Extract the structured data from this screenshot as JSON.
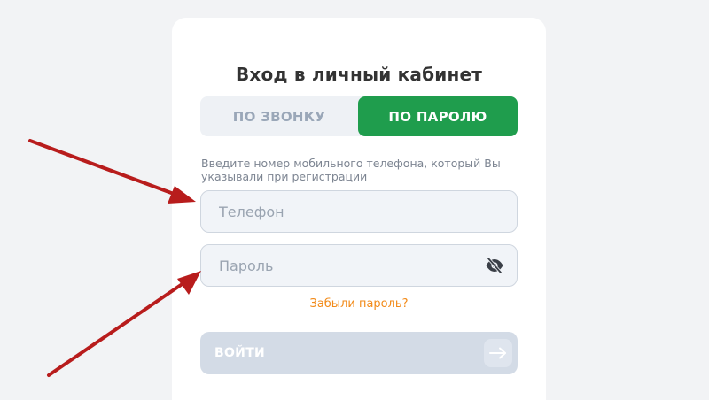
{
  "login": {
    "title": "Вход в личный кабинет",
    "tabs": [
      {
        "label": "ПО ЗВОНКУ",
        "active": false
      },
      {
        "label": "ПО ПАРОЛЮ",
        "active": true
      }
    ],
    "hint": "Введите номер мобильного телефона, который Вы указывали при регистрации",
    "phone": {
      "placeholder": "Телефон",
      "value": ""
    },
    "password": {
      "placeholder": "Пароль",
      "value": "",
      "toggle_icon": "eye-slash-icon"
    },
    "forgot_label": "Забыли пароль?",
    "submit_label": "ВОЙТИ",
    "submit_icon": "arrow-right-icon"
  },
  "colors": {
    "accent_green": "#1f9d4d",
    "link_orange": "#f28a18",
    "annotation_red": "#b81c1c"
  }
}
